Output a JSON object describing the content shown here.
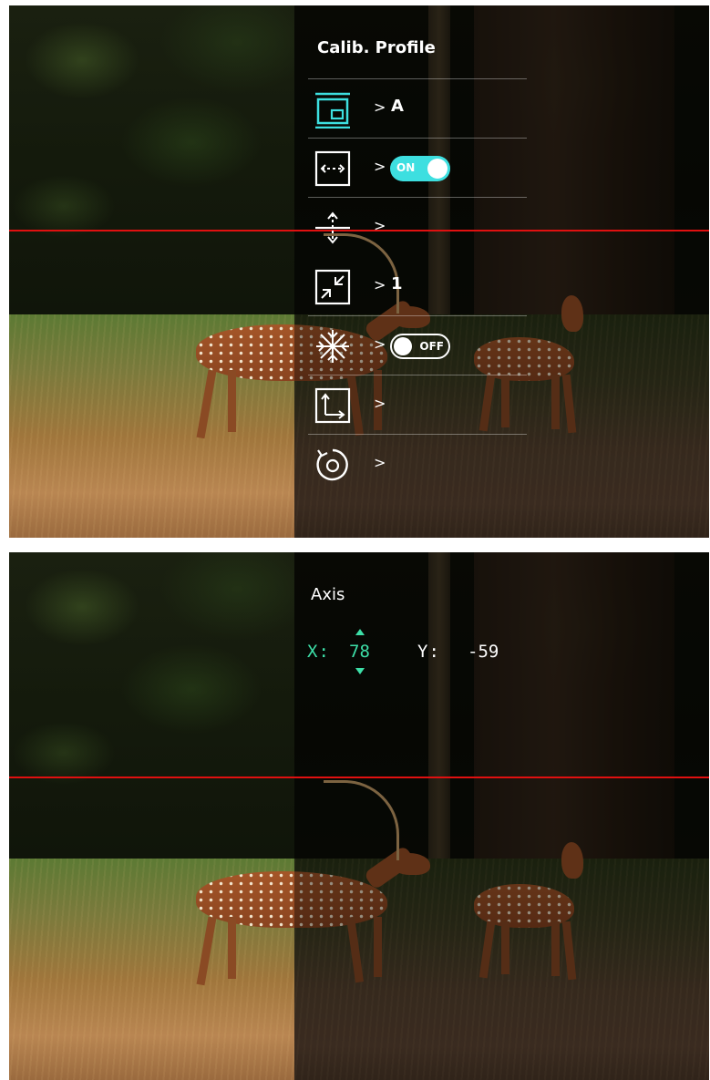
{
  "calibration_menu": {
    "title": "Calib. Profile",
    "items": [
      {
        "icon": "calib-profile-icon",
        "chevron": ">",
        "value": "A"
      },
      {
        "icon": "horizontal-distance-icon",
        "chevron": ">",
        "toggle": "ON"
      },
      {
        "icon": "vertical-adjust-icon",
        "chevron": ">"
      },
      {
        "icon": "zoom-scale-icon",
        "chevron": ">",
        "value": "1"
      },
      {
        "icon": "freeze-snowflake-icon",
        "chevron": ">",
        "toggle": "OFF"
      },
      {
        "icon": "axis-corner-icon",
        "chevron": ">"
      },
      {
        "icon": "reset-rotate-icon",
        "chevron": ">"
      }
    ]
  },
  "axis_panel": {
    "title": "Axis",
    "x_label": "X:",
    "x_value": "78",
    "y_label": "Y:",
    "y_value": "-59"
  },
  "colors": {
    "accent_cyan": "#3ddfe0",
    "accent_green": "#3ddfa8",
    "reticle_red": "#e01010"
  }
}
